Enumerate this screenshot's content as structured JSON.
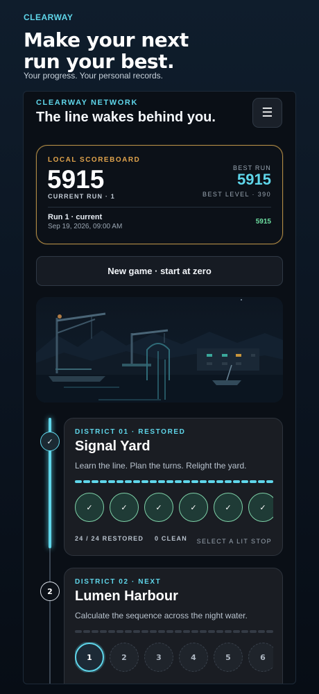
{
  "brand": "CLEARWAY",
  "hero": {
    "title": "Make your next run your best.",
    "subtitle": "Your progress. Your personal records."
  },
  "panel": {
    "kicker": "CLEARWAY NETWORK",
    "title": "The line wakes behind you.",
    "menu_icon": "☰"
  },
  "scoreboard": {
    "kicker": "LOCAL SCOREBOARD",
    "current_score": "5915",
    "current_run": "CURRENT RUN · 1",
    "best_label": "BEST RUN",
    "best_score": "5915",
    "best_level": "BEST LEVEL · 390",
    "entry": {
      "title": "Run 1 · current",
      "date": "Sep 19, 2026, 09:00 AM",
      "score": "5915"
    }
  },
  "new_game_label": "New game · start at zero",
  "districts": [
    {
      "node": "✓",
      "kicker": "DISTRICT 01 · RESTORED",
      "title": "Signal Yard",
      "description": "Learn the line. Plan the turns. Relight the yard.",
      "segments_total": 24,
      "segments_lit": 24,
      "stops": [
        "✓",
        "✓",
        "✓",
        "✓",
        "✓",
        "✓"
      ],
      "stats": "24 / 24 RESTORED",
      "clean": "0 CLEAN",
      "select": "SELECT A LIT STOP"
    },
    {
      "node": "2",
      "kicker": "DISTRICT 02 · NEXT",
      "title": "Lumen Harbour",
      "description": "Calculate the sequence across the night water.",
      "segments_total": 24,
      "segments_lit": 0,
      "stops": [
        "1",
        "2",
        "3",
        "4",
        "5",
        "6"
      ]
    }
  ],
  "colors": {
    "accent": "#5fd6ea",
    "gold": "#e0a34c",
    "success": "#6ee0a2"
  }
}
